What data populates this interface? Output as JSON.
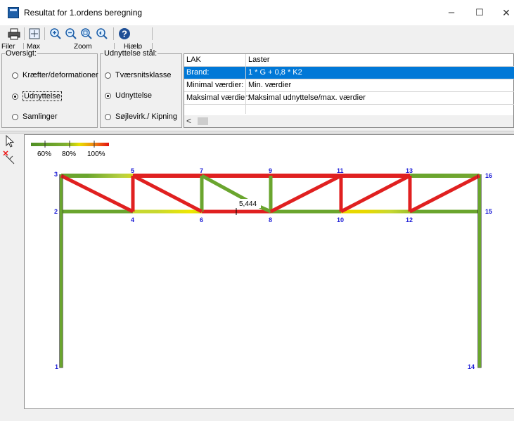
{
  "window": {
    "title": "Resultat for 1.ordens beregning",
    "minimize": "–",
    "maximize": "☐",
    "close": "✕"
  },
  "toolbar": {
    "groups": {
      "filer": "Filer",
      "max": "Max",
      "zoom": "Zoom",
      "hjaelp": "Hjælp"
    },
    "icons": [
      "printer-icon",
      "max-icon",
      "zoom-in-icon",
      "zoom-out-icon",
      "zoom-window-icon",
      "zoom-previous-icon",
      "help-icon"
    ]
  },
  "oversigt": {
    "title": "Oversigt:",
    "options": [
      "Kræfter/deformationer",
      "Udnyttelse",
      "Samlinger"
    ],
    "selected": 1
  },
  "udnyttelse_staal": {
    "title": "Udnyttelse stål:",
    "options": [
      "Tværsnitsklasse",
      "Udnyttelse",
      "Søjlevirk./ Kipning"
    ],
    "selected": 1
  },
  "load_table": {
    "headers": [
      "LAK",
      "Laster"
    ],
    "rows": [
      [
        "Brand:",
        "1 * G + 0,8 * K2"
      ],
      [
        "Minimal værdier:",
        "Min. værdier"
      ],
      [
        "Maksimal værdier:",
        "Maksimal udnyttelse/max. værdier"
      ]
    ],
    "selected_row": 0,
    "scroll_left": "<"
  },
  "legend": {
    "labels": [
      "60%",
      "80%",
      "100%"
    ],
    "colors": {
      "low": "#5a9e2a",
      "mid": "#f0e000",
      "high": "#e31010"
    }
  },
  "nodes": [
    "1",
    "2",
    "3",
    "4",
    "5",
    "6",
    "7",
    "8",
    "9",
    "10",
    "11",
    "12",
    "13",
    "14",
    "15",
    "16"
  ],
  "annotation": {
    "value": "5,444"
  },
  "colors": {
    "ok": "#6aa52e",
    "mid": "#e8e000",
    "high": "#e02020",
    "node_label": "#1a1ad6",
    "selection": "#0078d7"
  }
}
